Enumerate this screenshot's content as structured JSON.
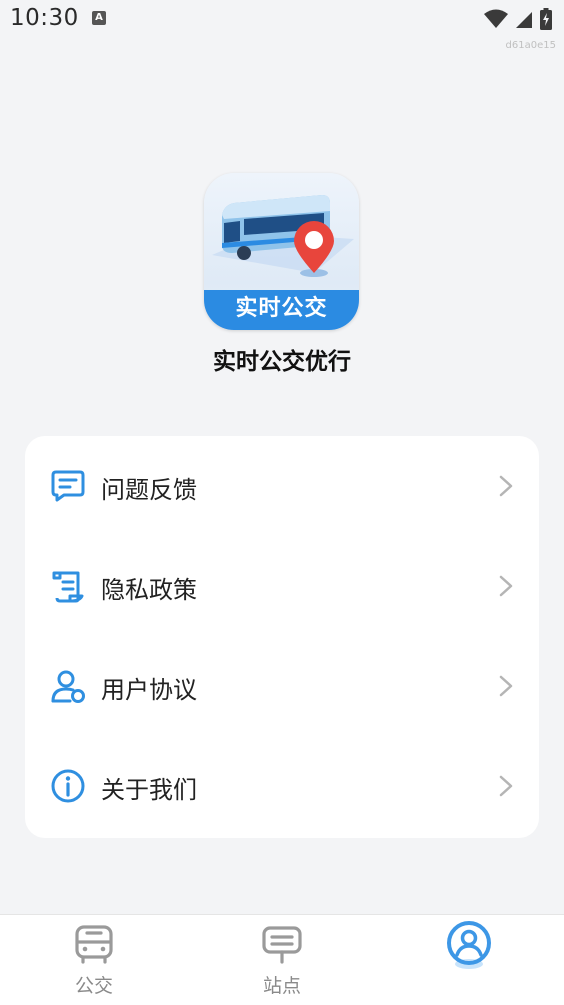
{
  "status_bar": {
    "time": "10:30",
    "a_badge": "A",
    "build_id": "d61a0e15"
  },
  "app": {
    "logo_band_text": "实时公交",
    "name": "实时公交优行",
    "accent_color": "#2b8be2"
  },
  "menu": {
    "items": [
      {
        "label": "问题反馈",
        "icon": "feedback-chat-icon"
      },
      {
        "label": "隐私政策",
        "icon": "document-scroll-icon"
      },
      {
        "label": "用户协议",
        "icon": "user-shield-icon"
      },
      {
        "label": "关于我们",
        "icon": "info-circle-icon"
      }
    ]
  },
  "tab_bar": {
    "tabs": [
      {
        "label": "公交",
        "icon": "bus-icon",
        "active": false
      },
      {
        "label": "站点",
        "icon": "bus-stop-sign-icon",
        "active": false
      },
      {
        "label": "",
        "icon": "profile-icon",
        "active": true
      }
    ]
  }
}
